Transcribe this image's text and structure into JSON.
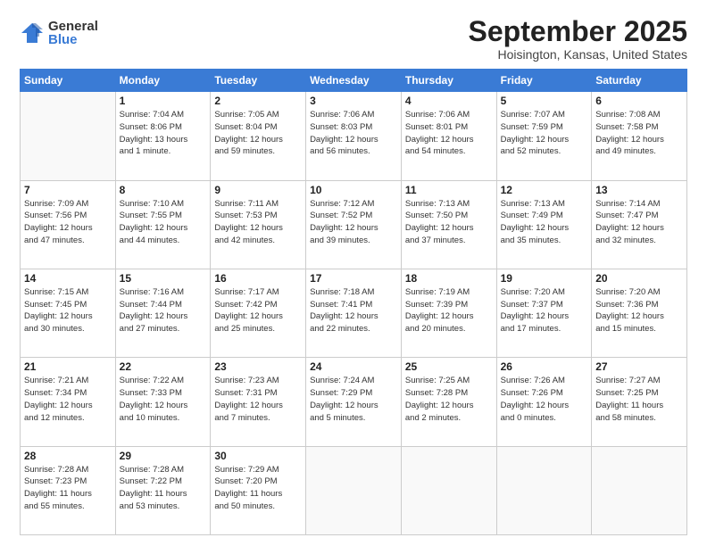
{
  "logo": {
    "general": "General",
    "blue": "Blue"
  },
  "title": "September 2025",
  "location": "Hoisington, Kansas, United States",
  "weekdays": [
    "Sunday",
    "Monday",
    "Tuesday",
    "Wednesday",
    "Thursday",
    "Friday",
    "Saturday"
  ],
  "weeks": [
    [
      {
        "day": "",
        "info": ""
      },
      {
        "day": "1",
        "info": "Sunrise: 7:04 AM\nSunset: 8:06 PM\nDaylight: 13 hours\nand 1 minute."
      },
      {
        "day": "2",
        "info": "Sunrise: 7:05 AM\nSunset: 8:04 PM\nDaylight: 12 hours\nand 59 minutes."
      },
      {
        "day": "3",
        "info": "Sunrise: 7:06 AM\nSunset: 8:03 PM\nDaylight: 12 hours\nand 56 minutes."
      },
      {
        "day": "4",
        "info": "Sunrise: 7:06 AM\nSunset: 8:01 PM\nDaylight: 12 hours\nand 54 minutes."
      },
      {
        "day": "5",
        "info": "Sunrise: 7:07 AM\nSunset: 7:59 PM\nDaylight: 12 hours\nand 52 minutes."
      },
      {
        "day": "6",
        "info": "Sunrise: 7:08 AM\nSunset: 7:58 PM\nDaylight: 12 hours\nand 49 minutes."
      }
    ],
    [
      {
        "day": "7",
        "info": "Sunrise: 7:09 AM\nSunset: 7:56 PM\nDaylight: 12 hours\nand 47 minutes."
      },
      {
        "day": "8",
        "info": "Sunrise: 7:10 AM\nSunset: 7:55 PM\nDaylight: 12 hours\nand 44 minutes."
      },
      {
        "day": "9",
        "info": "Sunrise: 7:11 AM\nSunset: 7:53 PM\nDaylight: 12 hours\nand 42 minutes."
      },
      {
        "day": "10",
        "info": "Sunrise: 7:12 AM\nSunset: 7:52 PM\nDaylight: 12 hours\nand 39 minutes."
      },
      {
        "day": "11",
        "info": "Sunrise: 7:13 AM\nSunset: 7:50 PM\nDaylight: 12 hours\nand 37 minutes."
      },
      {
        "day": "12",
        "info": "Sunrise: 7:13 AM\nSunset: 7:49 PM\nDaylight: 12 hours\nand 35 minutes."
      },
      {
        "day": "13",
        "info": "Sunrise: 7:14 AM\nSunset: 7:47 PM\nDaylight: 12 hours\nand 32 minutes."
      }
    ],
    [
      {
        "day": "14",
        "info": "Sunrise: 7:15 AM\nSunset: 7:45 PM\nDaylight: 12 hours\nand 30 minutes."
      },
      {
        "day": "15",
        "info": "Sunrise: 7:16 AM\nSunset: 7:44 PM\nDaylight: 12 hours\nand 27 minutes."
      },
      {
        "day": "16",
        "info": "Sunrise: 7:17 AM\nSunset: 7:42 PM\nDaylight: 12 hours\nand 25 minutes."
      },
      {
        "day": "17",
        "info": "Sunrise: 7:18 AM\nSunset: 7:41 PM\nDaylight: 12 hours\nand 22 minutes."
      },
      {
        "day": "18",
        "info": "Sunrise: 7:19 AM\nSunset: 7:39 PM\nDaylight: 12 hours\nand 20 minutes."
      },
      {
        "day": "19",
        "info": "Sunrise: 7:20 AM\nSunset: 7:37 PM\nDaylight: 12 hours\nand 17 minutes."
      },
      {
        "day": "20",
        "info": "Sunrise: 7:20 AM\nSunset: 7:36 PM\nDaylight: 12 hours\nand 15 minutes."
      }
    ],
    [
      {
        "day": "21",
        "info": "Sunrise: 7:21 AM\nSunset: 7:34 PM\nDaylight: 12 hours\nand 12 minutes."
      },
      {
        "day": "22",
        "info": "Sunrise: 7:22 AM\nSunset: 7:33 PM\nDaylight: 12 hours\nand 10 minutes."
      },
      {
        "day": "23",
        "info": "Sunrise: 7:23 AM\nSunset: 7:31 PM\nDaylight: 12 hours\nand 7 minutes."
      },
      {
        "day": "24",
        "info": "Sunrise: 7:24 AM\nSunset: 7:29 PM\nDaylight: 12 hours\nand 5 minutes."
      },
      {
        "day": "25",
        "info": "Sunrise: 7:25 AM\nSunset: 7:28 PM\nDaylight: 12 hours\nand 2 minutes."
      },
      {
        "day": "26",
        "info": "Sunrise: 7:26 AM\nSunset: 7:26 PM\nDaylight: 12 hours\nand 0 minutes."
      },
      {
        "day": "27",
        "info": "Sunrise: 7:27 AM\nSunset: 7:25 PM\nDaylight: 11 hours\nand 58 minutes."
      }
    ],
    [
      {
        "day": "28",
        "info": "Sunrise: 7:28 AM\nSunset: 7:23 PM\nDaylight: 11 hours\nand 55 minutes."
      },
      {
        "day": "29",
        "info": "Sunrise: 7:28 AM\nSunset: 7:22 PM\nDaylight: 11 hours\nand 53 minutes."
      },
      {
        "day": "30",
        "info": "Sunrise: 7:29 AM\nSunset: 7:20 PM\nDaylight: 11 hours\nand 50 minutes."
      },
      {
        "day": "",
        "info": ""
      },
      {
        "day": "",
        "info": ""
      },
      {
        "day": "",
        "info": ""
      },
      {
        "day": "",
        "info": ""
      }
    ]
  ]
}
